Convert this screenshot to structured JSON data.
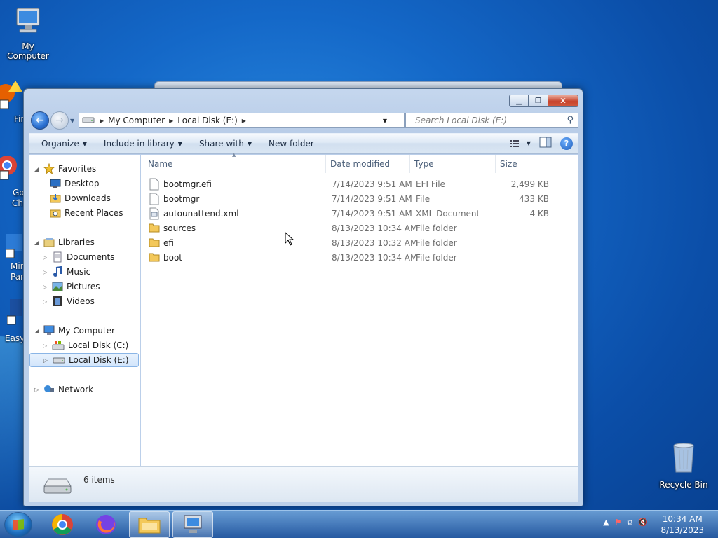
{
  "desktop": {
    "icons": [
      {
        "label": "My Computer"
      },
      {
        "label": "Recycle Bin"
      }
    ],
    "partial_labels": [
      "Fir",
      "Go",
      "Ch",
      "Mir",
      "Par",
      "Easy"
    ]
  },
  "window": {
    "address": {
      "crumbs": [
        "My Computer",
        "Local Disk (E:)"
      ]
    },
    "search_placeholder": "Search Local Disk (E:)",
    "toolbar": {
      "organize": "Organize",
      "include_in_library": "Include in library",
      "share_with": "Share with",
      "new_folder": "New folder"
    },
    "nav": {
      "favorites": "Favorites",
      "desktop": "Desktop",
      "downloads": "Downloads",
      "recent_places": "Recent Places",
      "libraries": "Libraries",
      "documents": "Documents",
      "music": "Music",
      "pictures": "Pictures",
      "videos": "Videos",
      "my_computer": "My Computer",
      "local_c": "Local Disk (C:)",
      "local_e": "Local Disk (E:)",
      "network": "Network"
    },
    "columns": {
      "name": "Name",
      "date_modified": "Date modified",
      "type": "Type",
      "size": "Size"
    },
    "files": [
      {
        "name": "bootmgr.efi",
        "date": "7/14/2023 9:51 AM",
        "type": "EFI File",
        "size": "2,499 KB",
        "icon": "file-icon"
      },
      {
        "name": "bootmgr",
        "date": "7/14/2023 9:51 AM",
        "type": "File",
        "size": "433 KB",
        "icon": "file-icon"
      },
      {
        "name": "autounattend.xml",
        "date": "7/14/2023 9:51 AM",
        "type": "XML Document",
        "size": "4 KB",
        "icon": "xml-file-icon"
      },
      {
        "name": "sources",
        "date": "8/13/2023 10:34 AM",
        "type": "File folder",
        "size": "",
        "icon": "folder-icon"
      },
      {
        "name": "efi",
        "date": "8/13/2023 10:32 AM",
        "type": "File folder",
        "size": "",
        "icon": "folder-icon"
      },
      {
        "name": "boot",
        "date": "8/13/2023 10:34 AM",
        "type": "File folder",
        "size": "",
        "icon": "folder-icon"
      }
    ],
    "status": {
      "items_count": "6 items"
    }
  },
  "taskbar": {
    "clock_time": "10:34 AM",
    "clock_date": "8/13/2023"
  },
  "colors": {
    "accent": "#1d5dbb",
    "close_button": "#c7432c",
    "folder": "#f3c85a"
  }
}
